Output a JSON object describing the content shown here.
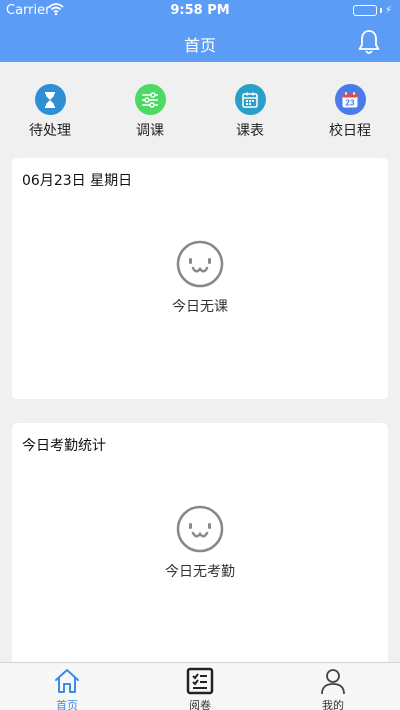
{
  "status_bar": {
    "carrier": "Carrier",
    "time": "9:58 PM",
    "battery_level": 1.0
  },
  "header": {
    "title": "首页",
    "bell_icon": "bell-icon"
  },
  "quick_actions": [
    {
      "label": "待处理",
      "icon": "hourglass-icon",
      "color": "#2f8fd5"
    },
    {
      "label": "调课",
      "icon": "sliders-icon",
      "color": "#4cd964"
    },
    {
      "label": "课表",
      "icon": "calendar-icon",
      "color": "#2aa0c8"
    },
    {
      "label": "校日程",
      "icon": "calendar-date-icon",
      "color": "#4a7be8",
      "date_text": "23"
    }
  ],
  "schedule_card": {
    "date_title": "06月23日  星期日",
    "empty_text": "今日无课"
  },
  "attendance_card": {
    "title": "今日考勤统计",
    "empty_text": "今日无考勤"
  },
  "tab_bar": {
    "active_color": "#3b8be8",
    "items": [
      {
        "label": "首页",
        "icon": "home-icon"
      },
      {
        "label": "阅卷",
        "icon": "checklist-icon"
      },
      {
        "label": "我的",
        "icon": "person-icon"
      }
    ]
  }
}
